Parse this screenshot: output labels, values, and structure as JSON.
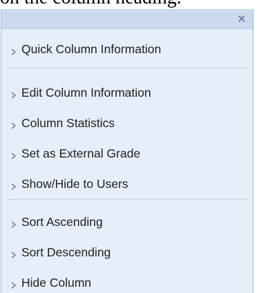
{
  "top_text": "on the column heading.",
  "close_icon": "close-icon",
  "sections": [
    {
      "items": [
        {
          "label": "Quick Column Information"
        }
      ]
    },
    {
      "items": [
        {
          "label": "Edit Column Information"
        },
        {
          "label": "Column Statistics"
        },
        {
          "label": "Set as External Grade"
        },
        {
          "label": "Show/Hide to Users"
        }
      ]
    },
    {
      "items": [
        {
          "label": "Sort Ascending"
        },
        {
          "label": "Sort Descending"
        },
        {
          "label": "Hide Column"
        }
      ]
    }
  ]
}
